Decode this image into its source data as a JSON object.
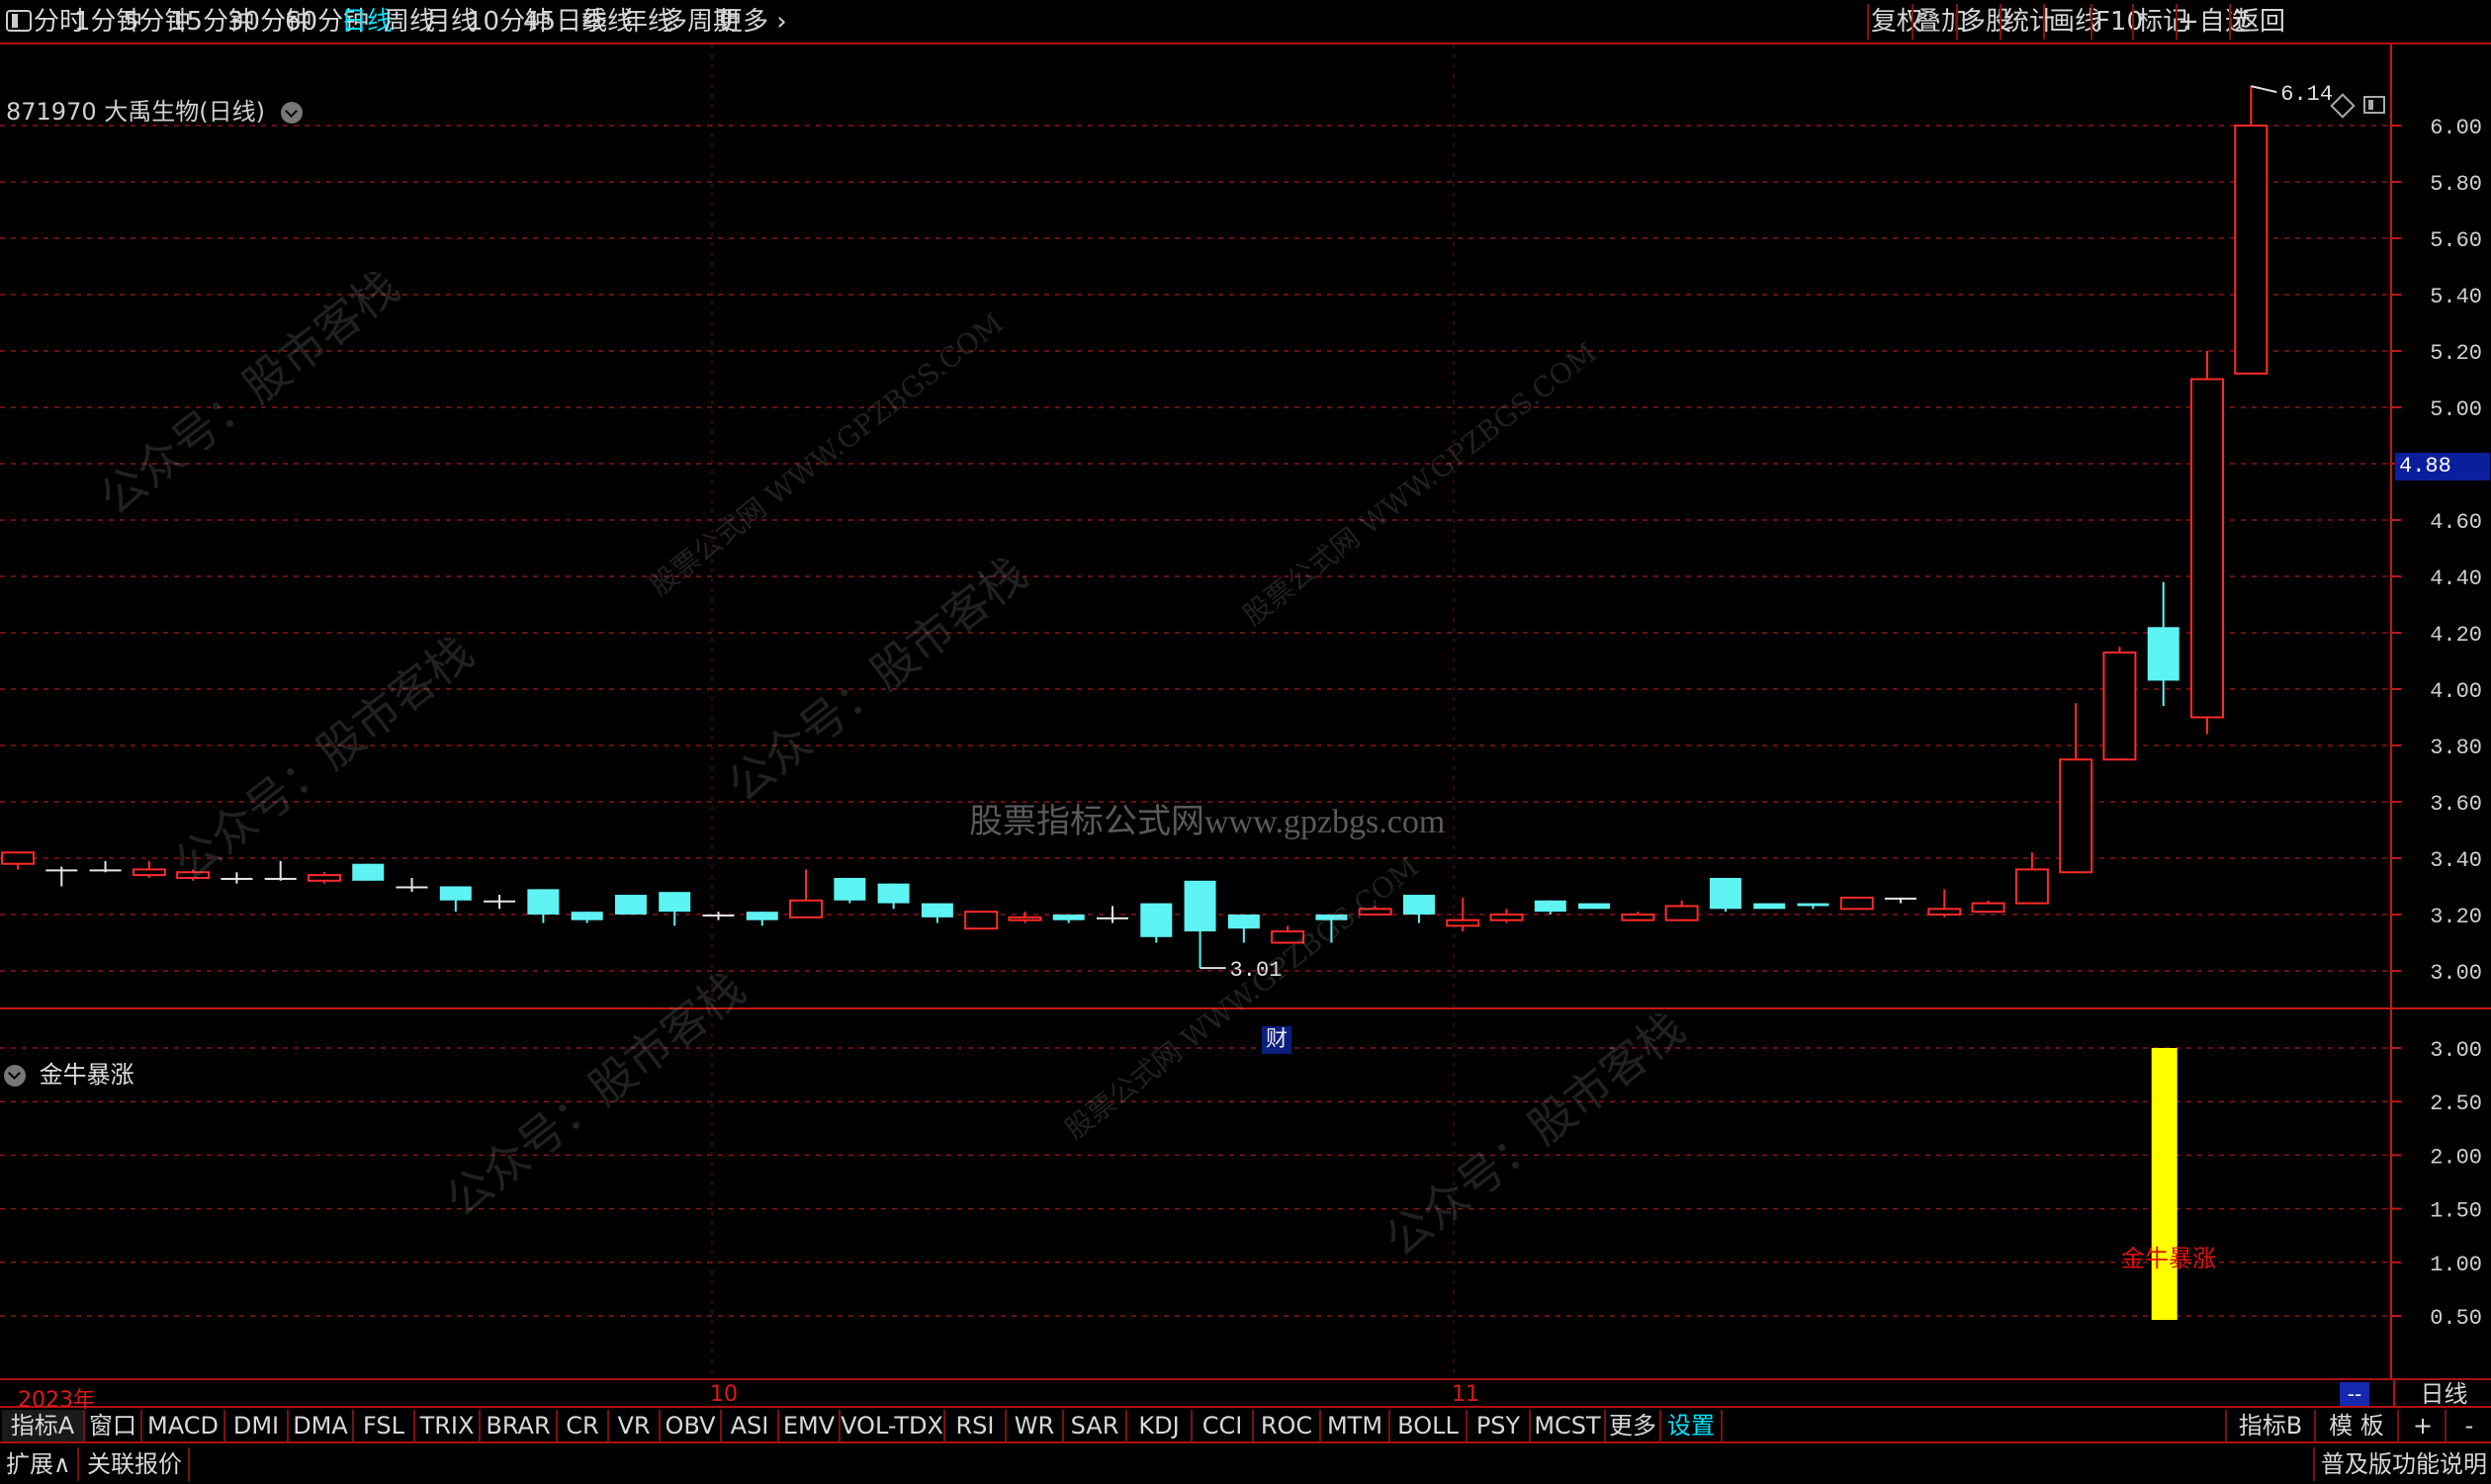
{
  "toolbar": {
    "periods": [
      "分时",
      "1分钟",
      "5分钟",
      "15分钟",
      "30分钟",
      "60分钟",
      "日线",
      "周线",
      "月线",
      "10分钟",
      "45日线",
      "季线",
      "年线",
      "多周期",
      "更多"
    ],
    "active_period": "日线",
    "right_buttons": [
      "复权",
      "叠加",
      "多股",
      "统计",
      "画线",
      "F10",
      "标记",
      "+自选",
      "返回"
    ]
  },
  "chart": {
    "title": "871970 大禹生物(日线)",
    "current_price": "4.88",
    "high_marker": "6.14",
    "low_marker": "3.01",
    "cai_badge": "财",
    "center_watermark": "股票指标公式网www.gpzbgs.com",
    "watermarks": [
      "公众号：股市客栈",
      "股票公式网 WWW.GPZBGS.COM"
    ]
  },
  "indicator": {
    "name": "金牛暴涨",
    "signal_label": "金牛暴涨",
    "signal_value": 3.0
  },
  "colors": {
    "up": "#ff2a2a",
    "down": "#5ef3f3",
    "doji": "#e6e6e6",
    "signal_bar": "#ffff00",
    "grid": "#8c1616",
    "active_tab": "#00e5ff"
  },
  "date_axis": {
    "year_label": "2023年",
    "oct_label": "10",
    "nov_label": "11",
    "period_label": "日线",
    "dash": "--"
  },
  "indicator_tabs": [
    "指标A",
    "窗口",
    "MACD",
    "DMI",
    "DMA",
    "FSL",
    "TRIX",
    "BRAR",
    "CR",
    "VR",
    "OBV",
    "ASI",
    "EMV",
    "VOL-TDX",
    "RSI",
    "WR",
    "SAR",
    "KDJ",
    "CCI",
    "ROC",
    "MTM",
    "BOLL",
    "PSY",
    "MCST",
    "更多",
    "设置"
  ],
  "right_tabs": [
    "指标B",
    "模 板",
    "+",
    "-"
  ],
  "bottom": {
    "expand": "扩展∧",
    "related_quotes": "关联报价",
    "feature_info": "普及版功能说明"
  },
  "chart_data": [
    {
      "type": "candlestick",
      "title": "871970 大禹生物(日线)",
      "y_ticks": [
        "6.00",
        "5.80",
        "5.60",
        "5.40",
        "5.20",
        "5.00",
        "4.80",
        "4.60",
        "4.40",
        "4.20",
        "4.00",
        "3.80",
        "3.60",
        "3.40",
        "3.20",
        "3.00"
      ],
      "ylim": [
        2.92,
        6.25
      ],
      "ohlc": [
        [
          3.38,
          3.42,
          3.36,
          3.42
        ],
        [
          3.36,
          3.37,
          3.3,
          3.36
        ],
        [
          3.36,
          3.39,
          3.35,
          3.36
        ],
        [
          3.34,
          3.39,
          3.33,
          3.36
        ],
        [
          3.33,
          3.36,
          3.32,
          3.35
        ],
        [
          3.33,
          3.35,
          3.31,
          3.33
        ],
        [
          3.33,
          3.39,
          3.32,
          3.33
        ],
        [
          3.32,
          3.35,
          3.31,
          3.34
        ],
        [
          3.38,
          3.38,
          3.32,
          3.32
        ],
        [
          3.3,
          3.33,
          3.28,
          3.3
        ],
        [
          3.3,
          3.3,
          3.21,
          3.25
        ],
        [
          3.25,
          3.27,
          3.22,
          3.25
        ],
        [
          3.29,
          3.29,
          3.17,
          3.2
        ],
        [
          3.21,
          3.21,
          3.17,
          3.18
        ],
        [
          3.27,
          3.27,
          3.2,
          3.2
        ],
        [
          3.28,
          3.28,
          3.16,
          3.21
        ],
        [
          3.2,
          3.21,
          3.18,
          3.2
        ],
        [
          3.21,
          3.21,
          3.16,
          3.18
        ],
        [
          3.19,
          3.36,
          3.19,
          3.25
        ],
        [
          3.33,
          3.33,
          3.24,
          3.25
        ],
        [
          3.31,
          3.31,
          3.22,
          3.24
        ],
        [
          3.24,
          3.24,
          3.17,
          3.19
        ],
        [
          3.15,
          3.21,
          3.15,
          3.21
        ],
        [
          3.18,
          3.21,
          3.17,
          3.19
        ],
        [
          3.2,
          3.2,
          3.17,
          3.18
        ],
        [
          3.19,
          3.23,
          3.17,
          3.19
        ],
        [
          3.24,
          3.24,
          3.1,
          3.12
        ],
        [
          3.32,
          3.32,
          3.01,
          3.14
        ],
        [
          3.2,
          3.2,
          3.1,
          3.15
        ],
        [
          3.1,
          3.16,
          3.1,
          3.14
        ],
        [
          3.2,
          3.2,
          3.1,
          3.18
        ],
        [
          3.2,
          3.23,
          3.2,
          3.22
        ],
        [
          3.27,
          3.27,
          3.17,
          3.2
        ],
        [
          3.16,
          3.26,
          3.14,
          3.18
        ],
        [
          3.18,
          3.22,
          3.17,
          3.2
        ],
        [
          3.25,
          3.25,
          3.2,
          3.21
        ],
        [
          3.24,
          3.24,
          3.22,
          3.22
        ],
        [
          3.18,
          3.21,
          3.18,
          3.2
        ],
        [
          3.18,
          3.25,
          3.18,
          3.23
        ],
        [
          3.33,
          3.33,
          3.21,
          3.22
        ],
        [
          3.24,
          3.24,
          3.22,
          3.22
        ],
        [
          3.24,
          3.24,
          3.22,
          3.23
        ],
        [
          3.22,
          3.26,
          3.22,
          3.26
        ],
        [
          3.26,
          3.26,
          3.24,
          3.26
        ],
        [
          3.2,
          3.29,
          3.19,
          3.22
        ],
        [
          3.21,
          3.25,
          3.21,
          3.24
        ],
        [
          3.24,
          3.42,
          3.24,
          3.36
        ],
        [
          3.35,
          3.95,
          3.35,
          3.75
        ],
        [
          3.75,
          4.15,
          3.75,
          4.13
        ],
        [
          4.22,
          4.38,
          3.94,
          4.03
        ],
        [
          3.9,
          5.2,
          3.84,
          5.1
        ],
        [
          5.12,
          6.14,
          5.12,
          6.0
        ]
      ],
      "indicator": {
        "name": "金牛暴涨",
        "y_ticks": [
          "3.00",
          "2.50",
          "2.00",
          "1.50",
          "1.00",
          "0.50"
        ],
        "ylim": [
          0,
          3.3
        ],
        "signal_index": 49,
        "signal_value": 3.0
      },
      "x_labels": [
        "2023年",
        "10",
        "11"
      ],
      "grid": true
    }
  ]
}
